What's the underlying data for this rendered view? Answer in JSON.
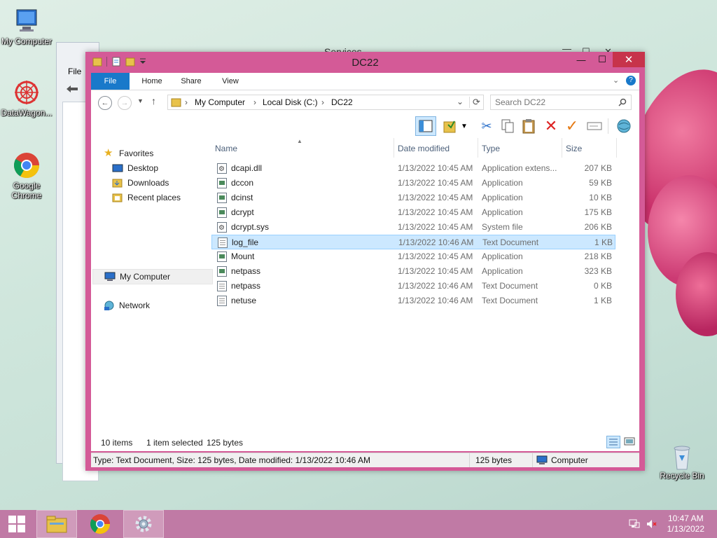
{
  "desktop": {
    "icons": [
      {
        "label": "My Computer"
      },
      {
        "label": "DataWagon..."
      },
      {
        "label": "Google Chrome"
      },
      {
        "label": "Recycle Bin"
      }
    ]
  },
  "background_window": {
    "title": "Services",
    "menu_file": "File"
  },
  "window": {
    "title": "DC22",
    "buttons": {
      "minimize": "—",
      "maximize": "☐",
      "close": "✕"
    }
  },
  "ribbon": {
    "tabs": [
      "File",
      "Home",
      "Share",
      "View"
    ]
  },
  "address": {
    "crumbs": [
      "My Computer",
      "Local Disk (C:)",
      "DC22"
    ],
    "search_placeholder": "Search DC22"
  },
  "nav": {
    "favorites": "Favorites",
    "favorites_items": [
      "Desktop",
      "Downloads",
      "Recent places"
    ],
    "my_computer": "My Computer",
    "network": "Network"
  },
  "columns": {
    "name": "Name",
    "date": "Date modified",
    "type": "Type",
    "size": "Size"
  },
  "files": [
    {
      "name": "dcapi.dll",
      "date": "1/13/2022 10:45 AM",
      "type": "Application extens...",
      "size": "207 KB",
      "icon": "dll"
    },
    {
      "name": "dccon",
      "date": "1/13/2022 10:45 AM",
      "type": "Application",
      "size": "59 KB",
      "icon": "app"
    },
    {
      "name": "dcinst",
      "date": "1/13/2022 10:45 AM",
      "type": "Application",
      "size": "10 KB",
      "icon": "app"
    },
    {
      "name": "dcrypt",
      "date": "1/13/2022 10:45 AM",
      "type": "Application",
      "size": "175 KB",
      "icon": "app"
    },
    {
      "name": "dcrypt.sys",
      "date": "1/13/2022 10:45 AM",
      "type": "System file",
      "size": "206 KB",
      "icon": "sys"
    },
    {
      "name": "log_file",
      "date": "1/13/2022 10:46 AM",
      "type": "Text Document",
      "size": "1 KB",
      "icon": "txt",
      "selected": true
    },
    {
      "name": "Mount",
      "date": "1/13/2022 10:45 AM",
      "type": "Application",
      "size": "218 KB",
      "icon": "app"
    },
    {
      "name": "netpass",
      "date": "1/13/2022 10:45 AM",
      "type": "Application",
      "size": "323 KB",
      "icon": "app"
    },
    {
      "name": "netpass",
      "date": "1/13/2022 10:46 AM",
      "type": "Text Document",
      "size": "0 KB",
      "icon": "txt"
    },
    {
      "name": "netuse",
      "date": "1/13/2022 10:46 AM",
      "type": "Text Document",
      "size": "1 KB",
      "icon": "txt"
    }
  ],
  "status": {
    "items": "10 items",
    "selected": "1 item selected",
    "bytes": "125 bytes"
  },
  "details": {
    "text": "Type: Text Document, Size: 125 bytes, Date modified: 1/13/2022 10:46 AM",
    "size": "125 bytes",
    "location": "Computer"
  },
  "taskbar": {
    "time": "10:47 AM",
    "date": "1/13/2022"
  },
  "colors": {
    "window_frame": "#d45a97",
    "selection": "#cce8ff",
    "file_tab": "#1979ca",
    "taskbar": "#c07aa5"
  }
}
